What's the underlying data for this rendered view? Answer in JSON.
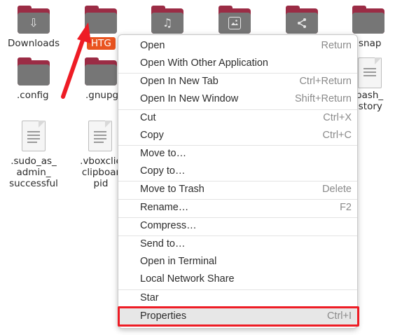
{
  "desktop": {
    "folders": [
      {
        "label": "Downloads",
        "emblem": "⇩",
        "icon": "download-icon"
      },
      {
        "label": "HTG",
        "emblem": "",
        "icon": "folder-icon"
      },
      {
        "label": "",
        "emblem": "♫",
        "icon": "music-icon"
      },
      {
        "label": "",
        "emblem": "▣",
        "icon": "image-icon"
      },
      {
        "label": "",
        "emblem": "⋖",
        "icon": "share-icon"
      },
      {
        "label": "snap",
        "emblem": "",
        "icon": "folder-icon"
      },
      {
        "label": ".config",
        "emblem": "",
        "icon": "folder-icon"
      },
      {
        "label": ".gnupg",
        "emblem": "",
        "icon": "folder-icon"
      }
    ],
    "files": [
      {
        "label_lines": [
          ".sudo_as_",
          "admin_",
          "successful"
        ]
      },
      {
        "label_lines": [
          ".vboxclie",
          "clipboar",
          "pid"
        ]
      },
      {
        "label_lines": [
          "bash_",
          "istory"
        ]
      }
    ]
  },
  "context_menu": {
    "items": [
      {
        "label": "Open",
        "shortcut": "Return"
      },
      {
        "label": "Open With Other Application",
        "shortcut": ""
      },
      {
        "label": "Open In New Tab",
        "shortcut": "Ctrl+Return"
      },
      {
        "label": "Open In New Window",
        "shortcut": "Shift+Return"
      },
      {
        "label": "Cut",
        "shortcut": "Ctrl+X"
      },
      {
        "label": "Copy",
        "shortcut": "Ctrl+C"
      },
      {
        "label": "Move to…",
        "shortcut": ""
      },
      {
        "label": "Copy to…",
        "shortcut": ""
      },
      {
        "label": "Move to Trash",
        "shortcut": "Delete"
      },
      {
        "label": "Rename…",
        "shortcut": "F2"
      },
      {
        "label": "Compress…",
        "shortcut": ""
      },
      {
        "label": "Send to…",
        "shortcut": ""
      },
      {
        "label": "Open in Terminal",
        "shortcut": ""
      },
      {
        "label": "Local Network Share",
        "shortcut": ""
      },
      {
        "label": "Star",
        "shortcut": ""
      },
      {
        "label": "Properties",
        "shortcut": "Ctrl+I"
      }
    ]
  },
  "colors": {
    "folder_back": "#9b2c45",
    "folder_front": "#767676",
    "selection": "#e95420",
    "annotation": "#ee1c25"
  }
}
